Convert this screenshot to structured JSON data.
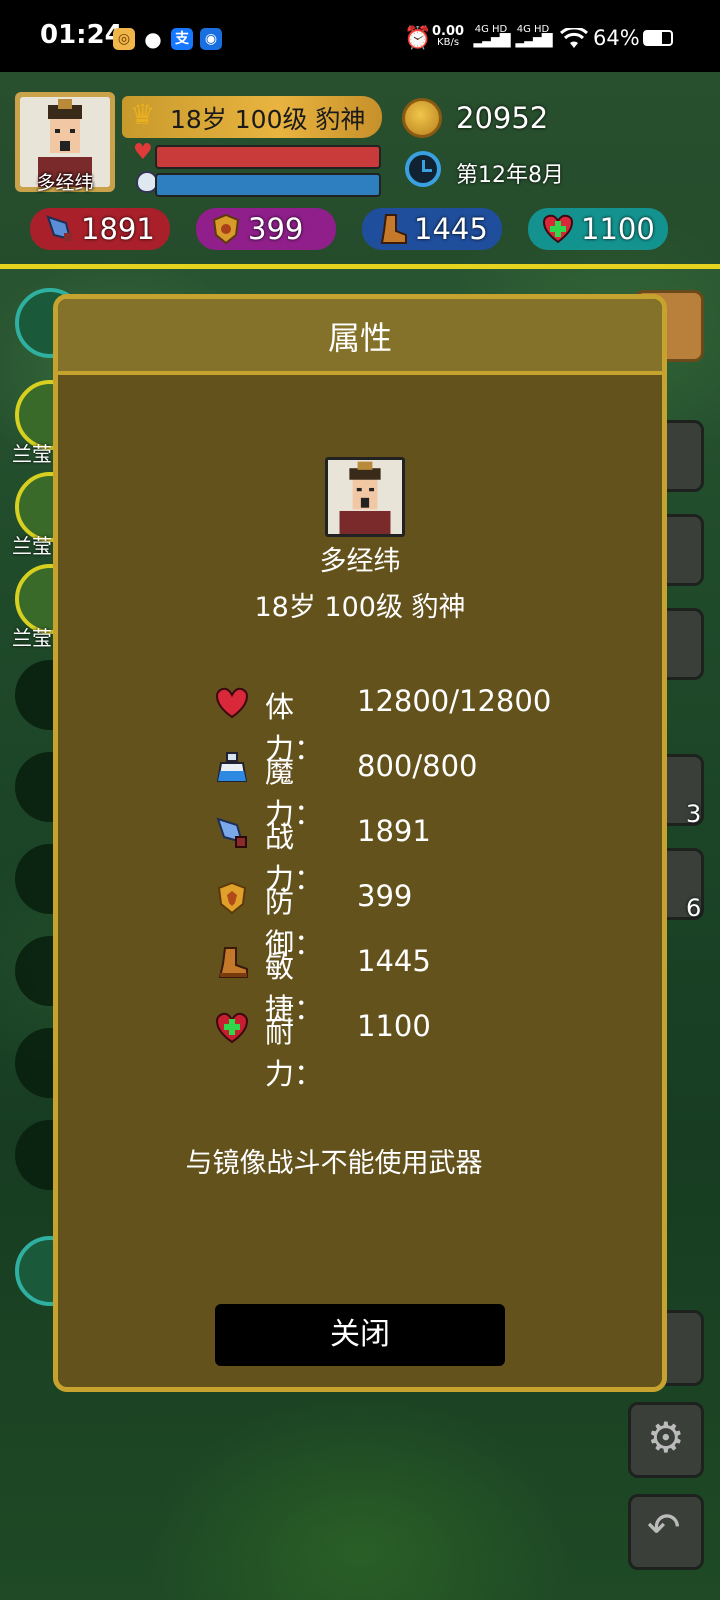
{
  "status_bar": {
    "time": "01:24",
    "net_speed": "0.00",
    "net_unit": "KB/s",
    "sim1": "4G HD",
    "sim2": "4G HD",
    "battery": "64%"
  },
  "hud": {
    "player_name": "多经纬",
    "level_text": "18岁 100级 豹神",
    "coins": "20952",
    "date": "第12年8月",
    "hp_fill": 1.0,
    "mp_fill": 1.0,
    "stats": {
      "attack": "1891",
      "defense": "399",
      "agility": "1445",
      "endurance": "1100"
    }
  },
  "side": {
    "left_labels": [
      "兰莹",
      "兰莹",
      "兰莹"
    ],
    "right_counts": [
      "3",
      "6"
    ]
  },
  "dialog": {
    "title": "属性",
    "name": "多经纬",
    "subtitle": "18岁 100级 豹神",
    "attributes": [
      {
        "icon": "heart-icon",
        "label": "体力：",
        "value": "12800/12800"
      },
      {
        "icon": "mana-potion-icon",
        "label": "魔力：",
        "value": "800/800"
      },
      {
        "icon": "sword-icon",
        "label": "战力：",
        "value": "1891"
      },
      {
        "icon": "shield-icon",
        "label": "防御：",
        "value": "399"
      },
      {
        "icon": "boot-icon",
        "label": "敏捷：",
        "value": "1445"
      },
      {
        "icon": "health-cross-icon",
        "label": "耐力：",
        "value": "1100"
      }
    ],
    "note": "与镜像战斗不能使用武器",
    "close_label": "关闭"
  },
  "colors": {
    "dialog_bg": "#64521d",
    "dialog_border": "#c6a22e",
    "hp_bar": "#c93a3a",
    "mp_bar": "#2e7fc0"
  }
}
